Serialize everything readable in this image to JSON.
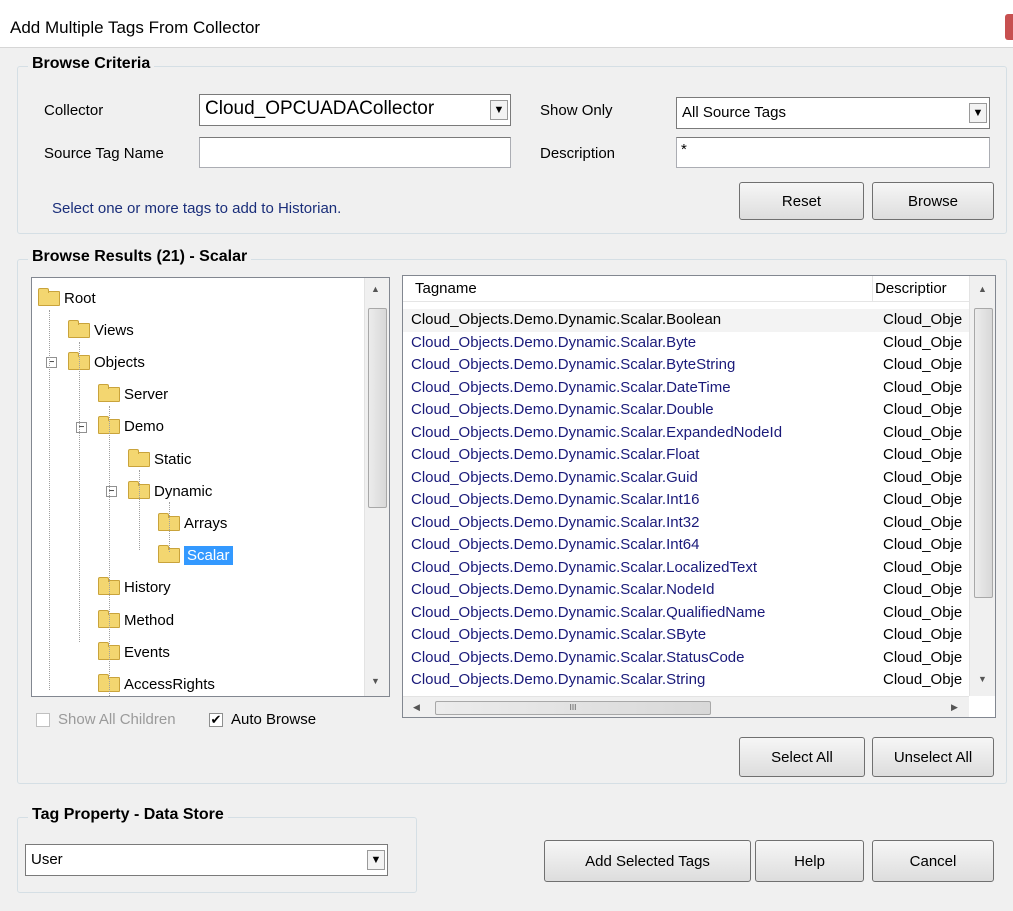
{
  "window": {
    "title": "Add Multiple Tags From Collector"
  },
  "browse_criteria": {
    "legend": "Browse Criteria",
    "collector_label": "Collector",
    "collector_value": "Cloud_OPCUADACollector",
    "show_only_label": "Show Only",
    "show_only_value": "All Source Tags",
    "source_tag_label": "Source Tag Name",
    "source_tag_value": "",
    "description_label": "Description",
    "description_value": "*",
    "hint": "Select one or more tags to add to Historian.",
    "reset_label": "Reset",
    "browse_label": "Browse"
  },
  "browse_results": {
    "legend": "Browse Results (21) - Scalar",
    "tree": [
      {
        "label": "Root"
      },
      {
        "label": "Views"
      },
      {
        "label": "Objects",
        "expander": "−"
      },
      {
        "label": "Server"
      },
      {
        "label": "Demo",
        "expander": "−"
      },
      {
        "label": "Static"
      },
      {
        "label": "Dynamic",
        "expander": "−"
      },
      {
        "label": "Arrays"
      },
      {
        "label": "Scalar"
      },
      {
        "label": "History"
      },
      {
        "label": "Method"
      },
      {
        "label": "Events"
      },
      {
        "label": "AccessRights"
      }
    ],
    "columns": {
      "tagname": "Tagname",
      "description": "Descriptior"
    },
    "rows": [
      {
        "tag": "Cloud_Objects.Demo.Dynamic.Scalar.Boolean",
        "desc": "Cloud_Obje"
      },
      {
        "tag": "Cloud_Objects.Demo.Dynamic.Scalar.Byte",
        "desc": "Cloud_Obje"
      },
      {
        "tag": "Cloud_Objects.Demo.Dynamic.Scalar.ByteString",
        "desc": "Cloud_Obje"
      },
      {
        "tag": "Cloud_Objects.Demo.Dynamic.Scalar.DateTime",
        "desc": "Cloud_Obje"
      },
      {
        "tag": "Cloud_Objects.Demo.Dynamic.Scalar.Double",
        "desc": "Cloud_Obje"
      },
      {
        "tag": "Cloud_Objects.Demo.Dynamic.Scalar.ExpandedNodeId",
        "desc": "Cloud_Obje"
      },
      {
        "tag": "Cloud_Objects.Demo.Dynamic.Scalar.Float",
        "desc": "Cloud_Obje"
      },
      {
        "tag": "Cloud_Objects.Demo.Dynamic.Scalar.Guid",
        "desc": "Cloud_Obje"
      },
      {
        "tag": "Cloud_Objects.Demo.Dynamic.Scalar.Int16",
        "desc": "Cloud_Obje"
      },
      {
        "tag": "Cloud_Objects.Demo.Dynamic.Scalar.Int32",
        "desc": "Cloud_Obje"
      },
      {
        "tag": "Cloud_Objects.Demo.Dynamic.Scalar.Int64",
        "desc": "Cloud_Obje"
      },
      {
        "tag": "Cloud_Objects.Demo.Dynamic.Scalar.LocalizedText",
        "desc": "Cloud_Obje"
      },
      {
        "tag": "Cloud_Objects.Demo.Dynamic.Scalar.NodeId",
        "desc": "Cloud_Obje"
      },
      {
        "tag": "Cloud_Objects.Demo.Dynamic.Scalar.QualifiedName",
        "desc": "Cloud_Obje"
      },
      {
        "tag": "Cloud_Objects.Demo.Dynamic.Scalar.SByte",
        "desc": "Cloud_Obje"
      },
      {
        "tag": "Cloud_Objects.Demo.Dynamic.Scalar.StatusCode",
        "desc": "Cloud_Obje"
      },
      {
        "tag": "Cloud_Objects.Demo.Dynamic.Scalar.String",
        "desc": "Cloud_Obje"
      }
    ],
    "show_all_children_label": "Show All Children",
    "show_all_children_checked": false,
    "auto_browse_label": "Auto Browse",
    "auto_browse_checked": true,
    "scroll_text": "III",
    "select_all_label": "Select All",
    "unselect_all_label": "Unselect All"
  },
  "tag_property": {
    "legend": "Tag Property - Data Store",
    "value": "User"
  },
  "footer": {
    "add_selected_label": "Add Selected Tags",
    "help_label": "Help",
    "cancel_label": "Cancel"
  },
  "colors": {
    "hint_text": "#1a2e7a",
    "tag_text": "#1a1a7a",
    "selection": "#3399ff",
    "folder": "#f3d670"
  },
  "icons": {
    "folder": "folder-icon",
    "dropdown": "chevron-down-icon",
    "expander": "collapse-icon",
    "check": "checkmark-icon"
  }
}
